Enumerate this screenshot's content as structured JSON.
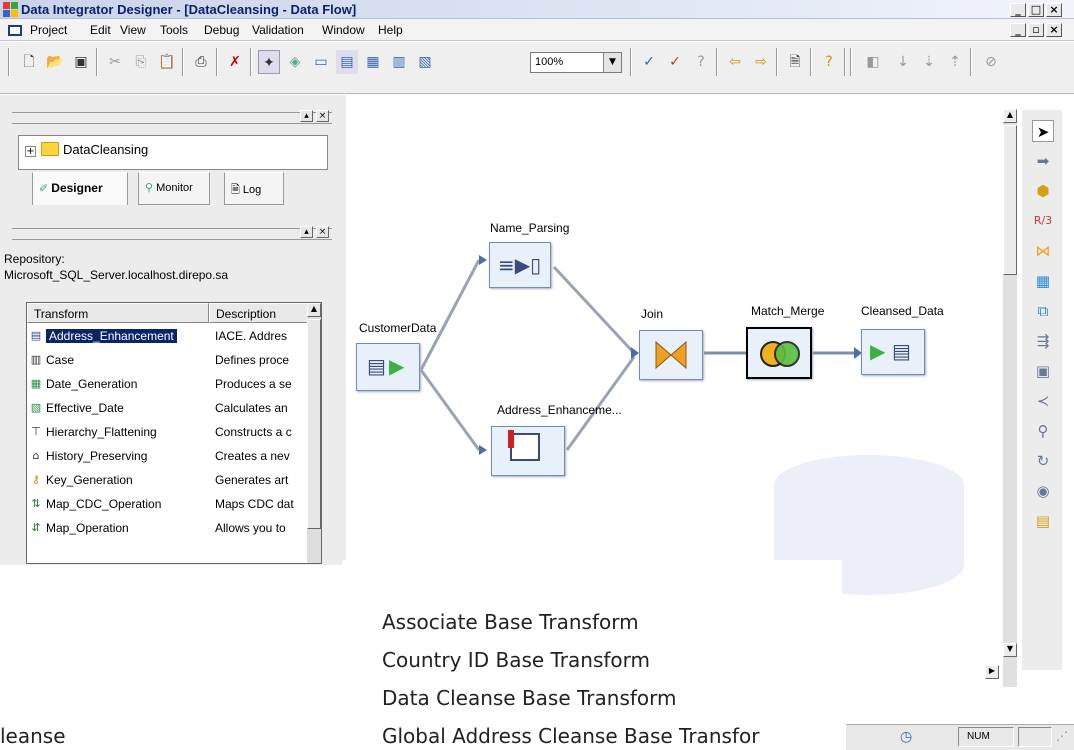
{
  "window": {
    "title": "Data Integrator Designer - [DataCleansing - Data Flow]"
  },
  "menu": [
    "Project",
    "Edit",
    "View",
    "Tools",
    "Debug",
    "Validation",
    "Window",
    "Help"
  ],
  "toolbar": {
    "zoom": "100%"
  },
  "project_area": {
    "tree_item": "DataCleansing",
    "tabs": [
      "Designer",
      "Monitor",
      "Log"
    ]
  },
  "local_library": {
    "repository_label": "Repository:",
    "repository_name": "Microsoft_SQL_Server.localhost.direpo.sa",
    "columns": [
      "Transform",
      "Description"
    ],
    "rows": [
      {
        "name": "Address_Enhancement",
        "desc": "IACE. Addres",
        "icon": "address-icon"
      },
      {
        "name": "Case",
        "desc": "Defines proce",
        "icon": "case-icon"
      },
      {
        "name": "Date_Generation",
        "desc": "Produces a se",
        "icon": "date-gen-icon"
      },
      {
        "name": "Effective_Date",
        "desc": "Calculates an",
        "icon": "effective-date-icon"
      },
      {
        "name": "Hierarchy_Flattening",
        "desc": "Constructs a c",
        "icon": "hierarchy-icon"
      },
      {
        "name": "History_Preserving",
        "desc": "Creates a nev",
        "icon": "history-icon"
      },
      {
        "name": "Key_Generation",
        "desc": "Generates art",
        "icon": "key-icon"
      },
      {
        "name": "Map_CDC_Operation",
        "desc": "Maps CDC dat",
        "icon": "map-cdc-icon"
      },
      {
        "name": "Map_Operation",
        "desc": "Allows you to",
        "icon": "map-op-icon"
      }
    ]
  },
  "dataflow": {
    "nodes": {
      "customer": "CustomerData",
      "name_parsing": "Name_Parsing",
      "address": "Address_Enhanceme...",
      "join": "Join",
      "match_merge": "Match_Merge",
      "cleansed": "Cleansed_Data"
    }
  },
  "overlay_list": [
    "Associate Base Transform",
    "Country ID Base Transform",
    "Data Cleanse Base Transform",
    "Global Address Cleanse Base Transfor"
  ],
  "overlay_left_fragment": "leanse",
  "status": {
    "num": "NUM"
  }
}
